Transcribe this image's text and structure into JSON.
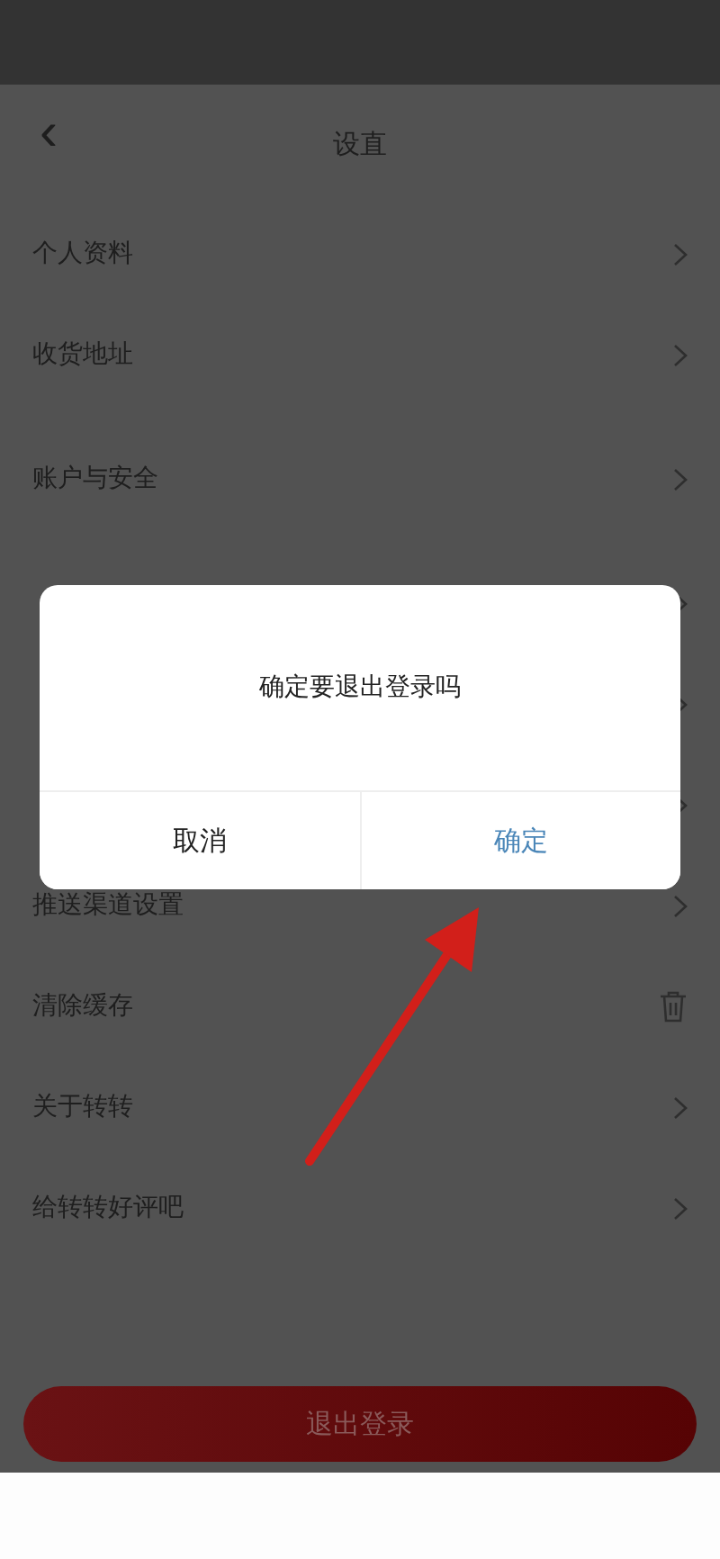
{
  "header": {
    "back": "‹",
    "title": "设直"
  },
  "rows": [
    {
      "kind": "link",
      "label": "个人资料"
    },
    {
      "kind": "link",
      "label": "收货地址"
    },
    {
      "kind": "link",
      "label": "账户与安全"
    },
    {
      "kind": "link"
    },
    {
      "kind": "link"
    },
    {
      "kind": "link"
    },
    {
      "kind": "link",
      "label": "推送渠道设置"
    },
    {
      "kind": "trash",
      "label": "清除缓存"
    },
    {
      "kind": "link",
      "label": "关于转转"
    },
    {
      "kind": "link",
      "label": "给转转好评吧"
    }
  ],
  "logout_button": "退出登录",
  "dialog": {
    "message": "确定要退出登录吗",
    "buttons": [
      {
        "label": "取消",
        "primary": false
      },
      {
        "label": "确定",
        "primary": true
      }
    ]
  }
}
